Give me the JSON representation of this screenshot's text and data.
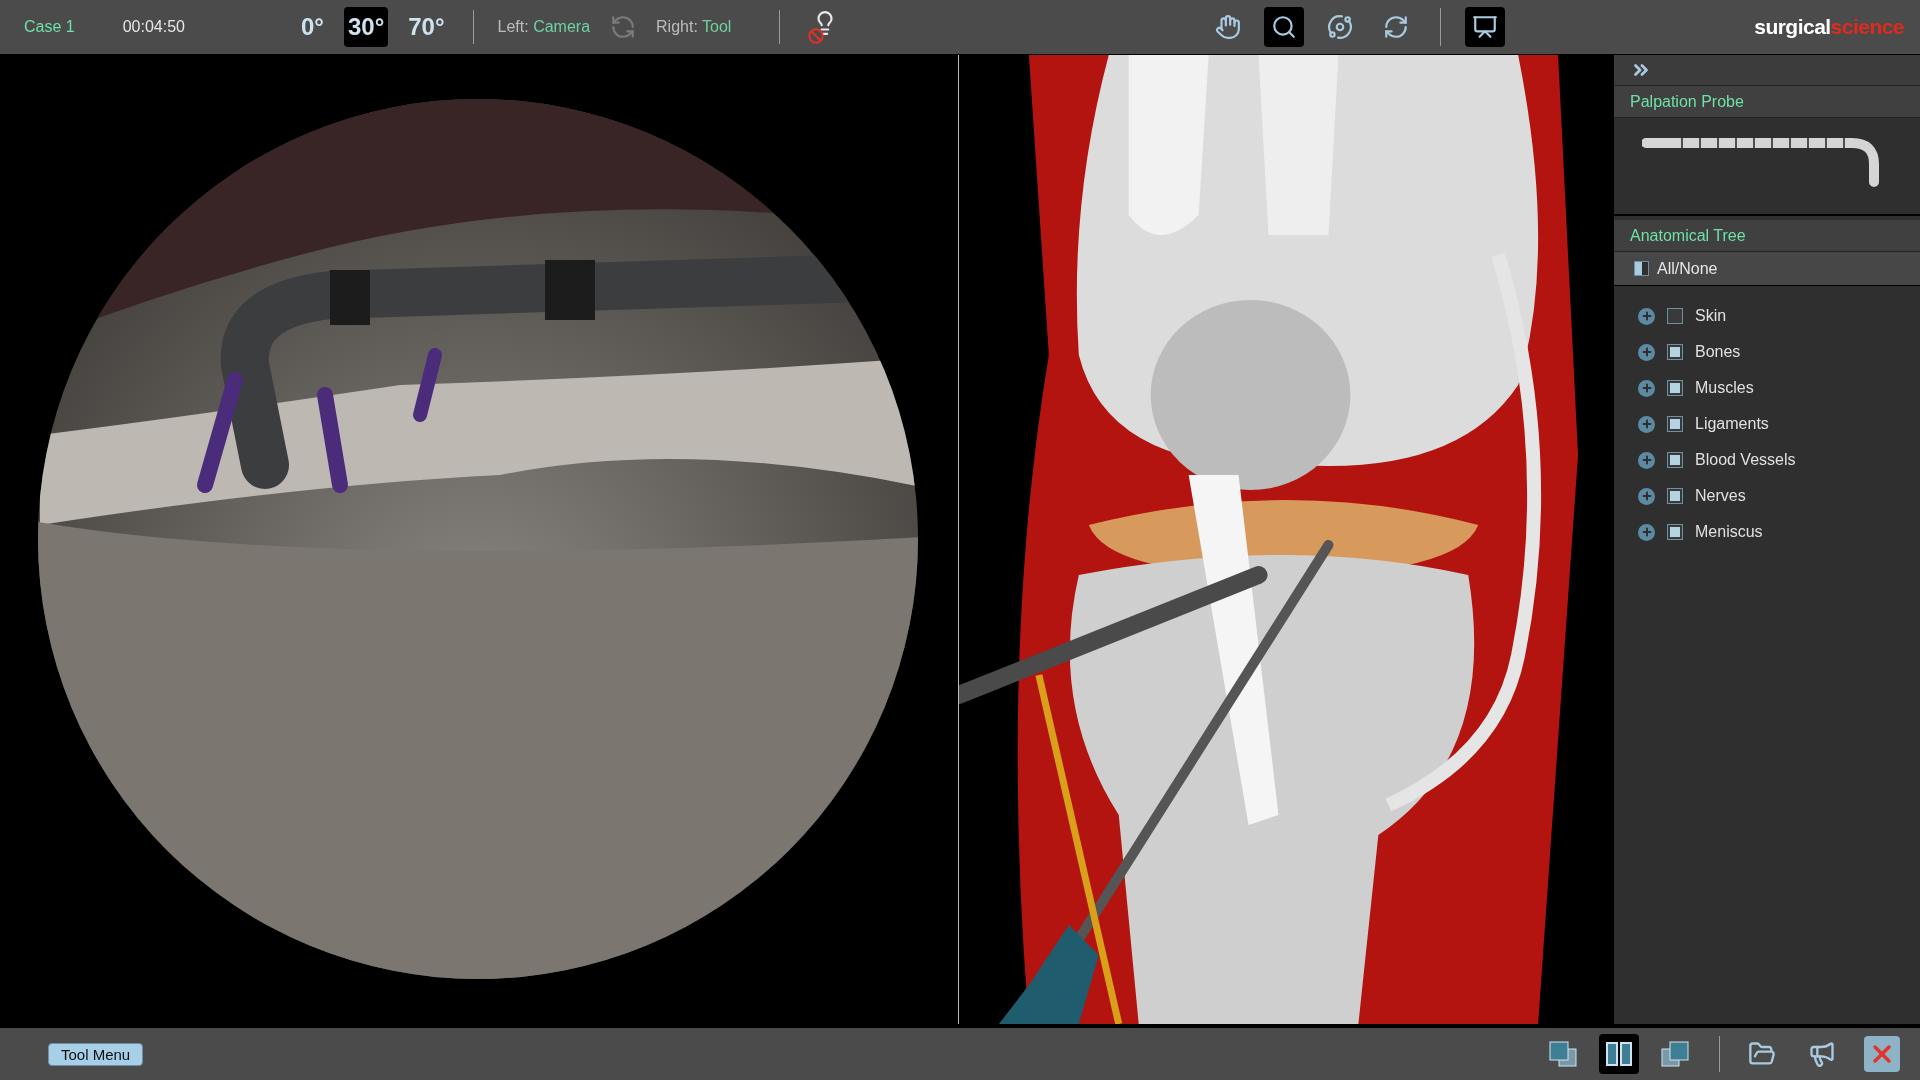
{
  "header": {
    "case": "Case 1",
    "timer": "00:04:50",
    "angles": [
      {
        "label": "0°",
        "selected": false
      },
      {
        "label": "30°",
        "selected": true
      },
      {
        "label": "70°",
        "selected": false
      }
    ],
    "left_label": "Left:",
    "left_value": "Camera",
    "right_label": "Right:",
    "right_value": "Tool",
    "light_off": true,
    "tools": [
      {
        "kind": "hand",
        "selected": false
      },
      {
        "kind": "zoom",
        "selected": true
      },
      {
        "kind": "orbit",
        "selected": false
      },
      {
        "kind": "reset",
        "selected": false
      }
    ],
    "annotation": {
      "selected": true
    },
    "logo": {
      "first": "surgical",
      "second": "science"
    }
  },
  "side_panel": {
    "probe": {
      "title": "Palpation Probe"
    },
    "tree": {
      "title": "Anatomical Tree",
      "all": {
        "label": "All/None",
        "mixed": true
      },
      "items": [
        {
          "label": "Skin",
          "checked": false,
          "expanded": false
        },
        {
          "label": "Bones",
          "checked": true,
          "expanded": false
        },
        {
          "label": "Muscles",
          "checked": true,
          "expanded": false
        },
        {
          "label": "Ligaments",
          "checked": true,
          "expanded": false
        },
        {
          "label": "Blood Vessels",
          "checked": true,
          "expanded": false
        },
        {
          "label": "Nerves",
          "checked": true,
          "expanded": false
        },
        {
          "label": "Meniscus",
          "checked": true,
          "expanded": false
        }
      ]
    }
  },
  "footer": {
    "tool_menu": "Tool Menu",
    "views": [
      {
        "kind": "left",
        "selected": false
      },
      {
        "kind": "split",
        "selected": true
      },
      {
        "kind": "right",
        "selected": false
      }
    ],
    "actions": [
      {
        "kind": "open"
      },
      {
        "kind": "sound"
      },
      {
        "kind": "close"
      }
    ]
  }
}
